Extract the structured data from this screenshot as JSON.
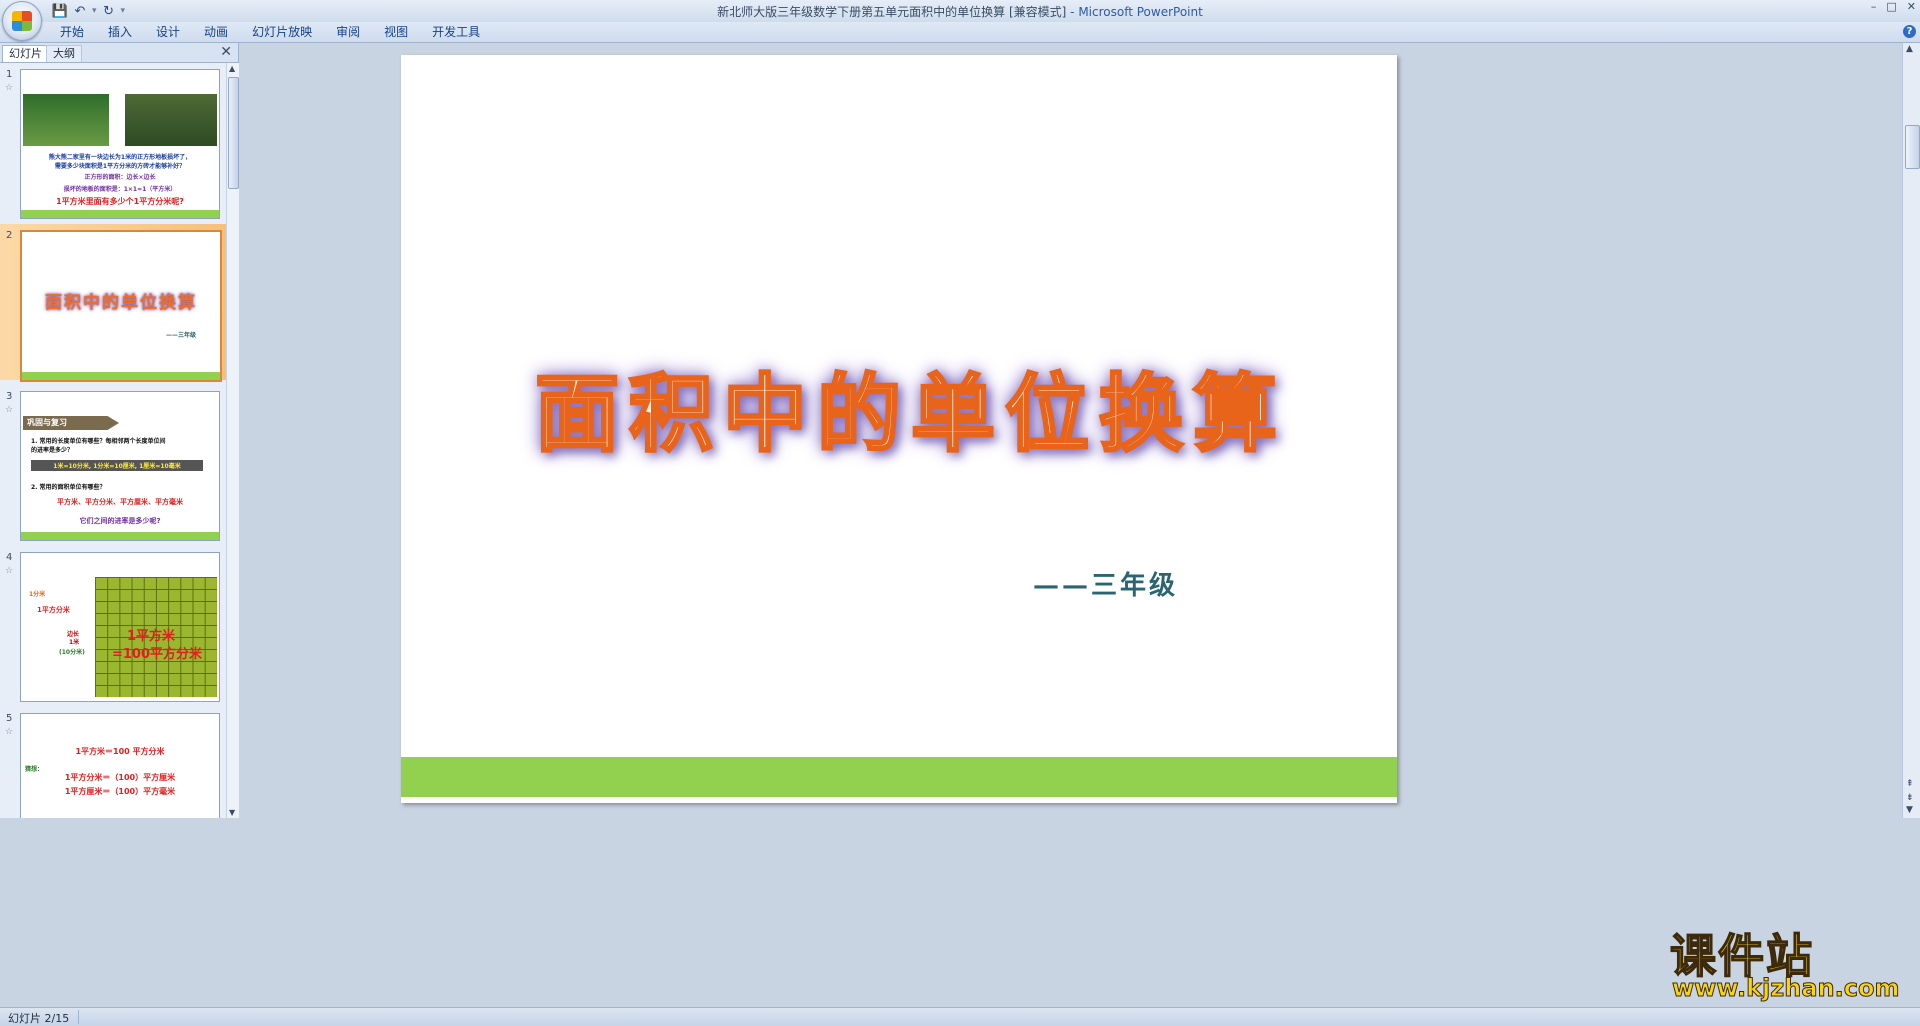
{
  "window": {
    "title": "新北师大版三年级数学下册第五单元面积中的单位换算 [兼容模式]",
    "app_name": "- Microsoft PowerPoint",
    "controls": [
      "–",
      "□",
      "✕"
    ]
  },
  "qat": {
    "sep": "▾"
  },
  "ribbon": {
    "tabs": [
      "开始",
      "插入",
      "设计",
      "动画",
      "幻灯片放映",
      "审阅",
      "视图",
      "开发工具"
    ],
    "help": "?"
  },
  "panel": {
    "tabs": [
      "幻灯片",
      "大纲"
    ],
    "close": "✕"
  },
  "thumbnails": [
    {
      "number": "1",
      "lines": [
        "熊大熊二家里有一块边长为1米的正方形地板损坏了，",
        "需要多少块面积是1平方分米的方砖才能够补好？",
        "正方形的面积：边长×边长",
        "损坏的地板的面积是：1×1=1（平方米）",
        "1平方米里面有多少个1平方分米呢?"
      ]
    },
    {
      "number": "2",
      "title": "面积中的单位换算",
      "sub": "——三年级"
    },
    {
      "number": "3",
      "tag": "巩固与复习",
      "lines": [
        "1. 常用的长度单位有哪些？每相邻两个长度单位间",
        "的进率是多少？",
        "1米=10分米, 1分米=10厘米, 1厘米=10毫米",
        "2. 常用的面积单位有哪些？",
        "平方米、平方分米、平方厘米、平方毫米",
        "它们之间的进率是多少呢?"
      ]
    },
    {
      "number": "4",
      "lines": [
        "1分米",
        "1平方分米",
        "边长",
        "1米",
        "(10分米)",
        "1平方米",
        "=100平方分米"
      ]
    },
    {
      "number": "5",
      "lines": [
        "1平方米＝100 平方分米",
        "猜想：",
        "1平方分米＝（100）平方厘米",
        "1平方厘米＝（100）平方毫米"
      ]
    }
  ],
  "slide": {
    "title": "面积中的单位换算",
    "subtitle": "——三年级",
    "bar_color": "#92d050"
  },
  "statusbar": {
    "text": "幻灯片 2/15"
  },
  "watermark": {
    "main": "课件站",
    "url": "www.kjzhan.com"
  },
  "colors": {
    "accent_orange": "#f26d21",
    "slide_bar": "#92d050",
    "title_glow": "#8a74c4"
  }
}
